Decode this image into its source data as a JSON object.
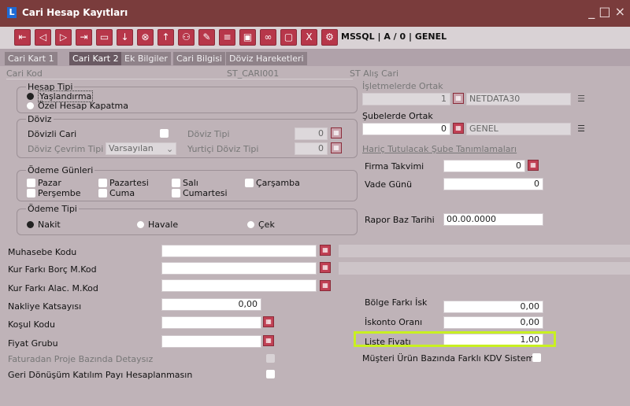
{
  "window": {
    "title": "Cari Hesap Kayıtları",
    "controls": "_ □ ×"
  },
  "toolbar": {
    "connection": "MSSQL | A / 0 | GENEL"
  },
  "tabs": [
    "Cari Kart 1",
    "Cari Kart 2",
    "Ek Bilgiler",
    "Cari Bilgisi",
    "Döviz Hareketleri"
  ],
  "header": {
    "cari_kod_label": "Cari Kod",
    "cari_kod_value": "ST_CARI001",
    "cari_name": "ST Alış Cari"
  },
  "hesap_tipi": {
    "title": "Hesap Tipi",
    "opt1": "Yaşlandırma",
    "opt2": "Özel Hesap Kapatma"
  },
  "doviz": {
    "title": "Döviz",
    "dovizli_cari": "Dövizli Cari",
    "doviz_tipi": "Döviz Tipi",
    "doviz_tipi_value": "0",
    "cevrim_tipi": "Döviz Çevrim Tipi",
    "cevrim_value": "Varsayılan",
    "yurtici_doviz_tipi": "Yurtiçi Döviz Tipi",
    "yurtici_value": "0"
  },
  "odeme_gunleri": {
    "title": "Ödeme Günleri",
    "days": [
      "Pazar",
      "Pazartesi",
      "Salı",
      "Çarşamba",
      "Perşembe",
      "Cuma",
      "Cumartesi"
    ]
  },
  "odeme_tipi": {
    "title": "Ödeme Tipi",
    "nakit": "Nakit",
    "havale": "Havale",
    "cek": "Çek"
  },
  "right": {
    "isletme_label": "İşletmelerde Ortak",
    "isletme_no": "1",
    "isletme_name": "NETDATA30",
    "sube_label": "Şubelerde Ortak",
    "sube_no": "0",
    "sube_name": "GENEL",
    "haric_link": "Hariç Tutulacak Şube Tanımlamaları",
    "firma_takvimi": "Firma Takvimi",
    "firma_takvimi_value": "0",
    "vade_gunu": "Vade Günü",
    "vade_gunu_value": "0",
    "rapor_baz_tarihi": "Rapor Baz Tarihi",
    "rapor_baz_tarihi_value": "00.00.0000"
  },
  "bottom": {
    "muhasebe_kodu": "Muhasebe Kodu",
    "kur_farki_borc": "Kur Farkı Borç M.Kod",
    "kur_farki_alac": "Kur Farkı Alac. M.Kod",
    "nakliye_katsayisi": "Nakliye Katsayısı",
    "nakliye_value": "0,00",
    "kosul_kodu": "Koşul Kodu",
    "fiyat_grubu": "Fiyat Grubu",
    "faturadan": "Faturadan Proje Bazında Detaysız",
    "geri_donusum": "Geri Dönüşüm Katılım Payı Hesaplanmasın",
    "bolge_farki": "Bölge Farkı İsk",
    "bolge_value": "0,00",
    "iskonto_orani": "İskonto Oranı",
    "iskonto_value": "0,00",
    "liste_fiyati": "Liste Fiyatı",
    "liste_value": "1,00",
    "musteri_urun": "Müşteri Ürün Bazında Farklı KDV Sistemi"
  }
}
